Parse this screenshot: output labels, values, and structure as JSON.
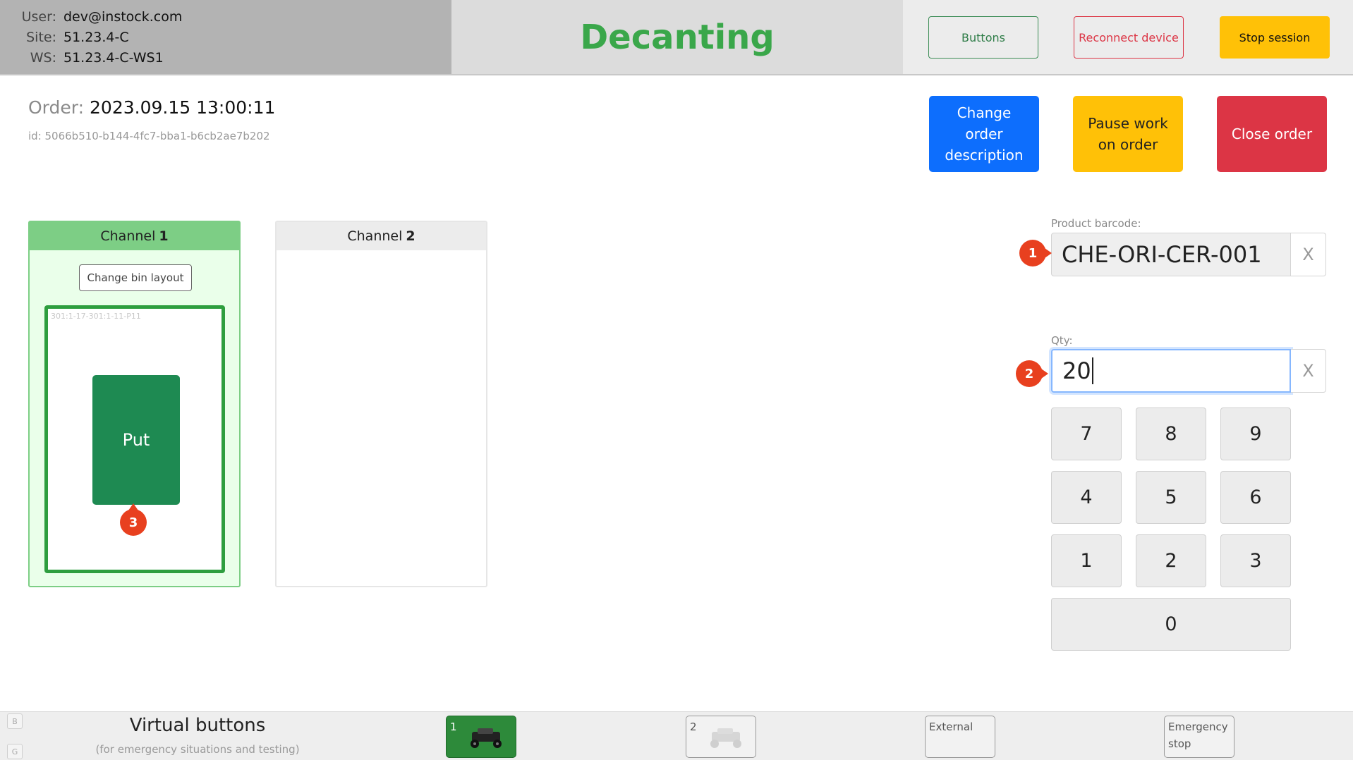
{
  "header": {
    "user_label": "User:",
    "user_value": "dev@instock.com",
    "site_label": "Site:",
    "site_value": "51.23.4-C",
    "ws_label": "WS:",
    "ws_value": "51.23.4-C-WS1",
    "title": "Decanting",
    "buttons_label": "Buttons",
    "reconnect_label": "Reconnect device",
    "stop_label": "Stop session"
  },
  "order": {
    "label": "Order:",
    "value": "2023.09.15 13:00:11",
    "id": "id: 5066b510-b144-4fc7-bba1-b6cb2ae7b202",
    "change_description_label": "Change order description",
    "pause_label": "Pause work on order",
    "close_label": "Close order"
  },
  "channels": [
    {
      "name": "Channel",
      "number": "1",
      "change_layout_label": "Change bin layout",
      "bin_label": "301:1-17-301:1-11-P11",
      "put_label": "Put"
    },
    {
      "name": "Channel",
      "number": "2"
    }
  ],
  "markers": [
    "1",
    "2",
    "3"
  ],
  "barcode": {
    "label": "Product barcode:",
    "value": "CHE-ORI-CER-001",
    "clear": "X"
  },
  "qty": {
    "label": "Qty:",
    "value": "20",
    "clear": "X"
  },
  "keypad": [
    "7",
    "8",
    "9",
    "4",
    "5",
    "6",
    "1",
    "2",
    "3",
    "0"
  ],
  "footer": {
    "key_b": "B",
    "key_g": "G",
    "title": "Virtual buttons",
    "subtitle": "(for emergency situations and testing)",
    "buttons": [
      {
        "label": "1",
        "icon": "robot-car-icon",
        "active": true
      },
      {
        "label": "2",
        "icon": "robot-car-icon",
        "active": false
      },
      {
        "label": "External"
      },
      {
        "label": "Emergency stop"
      }
    ]
  },
  "colors": {
    "title_green": "#3aa74a",
    "channel_active": "#7dce85",
    "put_green": "#1e8a52",
    "primary_blue": "#0d6efd",
    "warning_yellow": "#ffc107",
    "danger_red": "#dc3545",
    "marker_red": "#e8401f"
  }
}
